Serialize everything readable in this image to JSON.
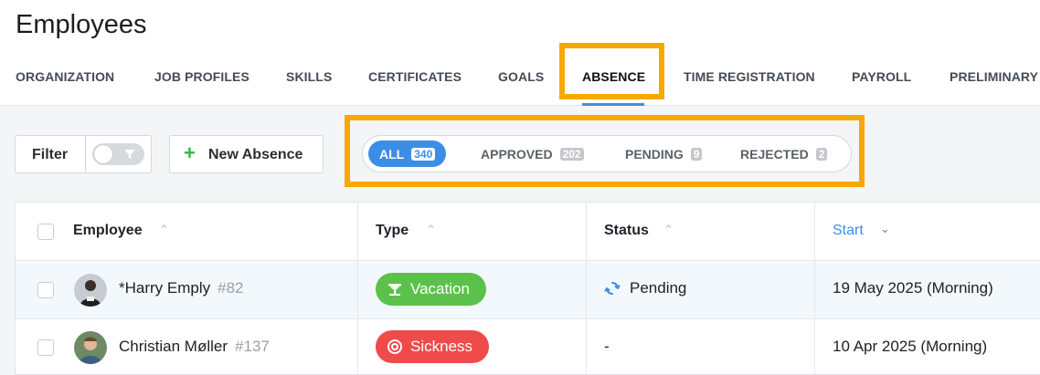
{
  "page": {
    "title": "Employees"
  },
  "tabs": [
    {
      "label": "ORGANIZATION",
      "active": false
    },
    {
      "label": "JOB PROFILES",
      "active": false
    },
    {
      "label": "SKILLS",
      "active": false
    },
    {
      "label": "CERTIFICATES",
      "active": false
    },
    {
      "label": "GOALS",
      "active": false
    },
    {
      "label": "ABSENCE",
      "active": true
    },
    {
      "label": "TIME REGISTRATION",
      "active": false
    },
    {
      "label": "PAYROLL",
      "active": false
    },
    {
      "label": "PRELIMINARY",
      "active": false
    }
  ],
  "toolbar": {
    "filter_label": "Filter",
    "filter_toggle_on": false,
    "new_absence_label": "New Absence"
  },
  "status_filter": [
    {
      "label": "ALL",
      "count": "340",
      "active": true
    },
    {
      "label": "APPROVED",
      "count": "202",
      "active": false
    },
    {
      "label": "PENDING",
      "count": "9",
      "active": false
    },
    {
      "label": "REJECTED",
      "count": "2",
      "active": false
    }
  ],
  "table": {
    "columns": [
      {
        "label": "Employee",
        "sort": "asc"
      },
      {
        "label": "Type",
        "sort": "asc"
      },
      {
        "label": "Status",
        "sort": "asc"
      },
      {
        "label": "Start",
        "sort": "desc-active"
      }
    ],
    "rows": [
      {
        "name": "*Harry Emply",
        "number": "#82",
        "type": "Vacation",
        "type_color": "#5cc14b",
        "type_icon": "beach-umbrella-icon",
        "status": "Pending",
        "status_icon": "sync-icon",
        "start": "19 May 2025 (Morning)"
      },
      {
        "name": "Christian Møller",
        "number": "#137",
        "type": "Sickness",
        "type_color": "#ef4b4b",
        "type_icon": "lifebuoy-icon",
        "status": "-",
        "status_icon": "",
        "start": "10 Apr 2025 (Morning)"
      }
    ]
  },
  "colors": {
    "accent": "#3b8ee6",
    "highlight": "#f7a800"
  }
}
